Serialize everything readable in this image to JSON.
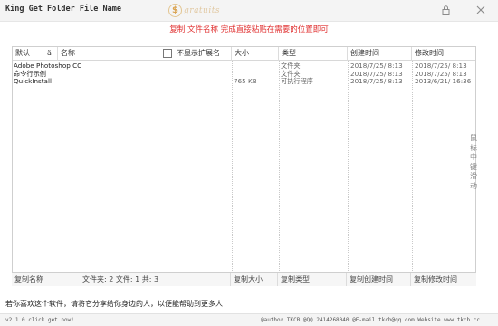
{
  "window": {
    "title": "King Get Folder File Name",
    "logo_badge": "$",
    "logo_text": "gratuits",
    "lock_icon": "lock-icon",
    "close_icon": "close-icon"
  },
  "hint": {
    "text": "复制 文件名称 完成直接粘贴在需要的位置即可",
    "color": "#e03030"
  },
  "table": {
    "headers": {
      "default": "默认",
      "sort_arrow": "ä",
      "name": "名称",
      "hide_ext": "不显示扩展名",
      "size": "大小",
      "type": "类型",
      "created": "创建时间",
      "modified": "修改时间"
    },
    "rows": [
      {
        "name": "Adobe Photoshop CC",
        "size": "",
        "type": "文件夹",
        "created": "2018/7/25/ 8:13",
        "modified": "2018/7/25/ 8:13"
      },
      {
        "name": "命令行示例",
        "size": "",
        "type": "文件夹",
        "created": "2018/7/25/ 8:13",
        "modified": "2018/7/25/ 8:13"
      },
      {
        "name": "QuickInstall",
        "size": "765 KB",
        "type": "可执行程序",
        "created": "2018/7/25/ 8:13",
        "modified": "2013/6/21/ 16:36"
      }
    ],
    "side_hint": "鼠标中键滑动"
  },
  "footer": {
    "copy_name": "复制名称",
    "counts": "文件夹: 2  文件: 1  共: 3",
    "copy_size": "复制大小",
    "copy_type": "复制类型",
    "copy_created": "复制创建时间",
    "copy_modified": "复制修改时间"
  },
  "share_text": "若你喜欢这个软件，请将它分享给你身边的人，以便能帮助到更多人",
  "status": {
    "left": "v2.1.0     click get now!",
    "right": "@author TKCB   @QQ 2414268040   @E-mail tkcb@qq.com   Website www.tkcb.cc"
  }
}
